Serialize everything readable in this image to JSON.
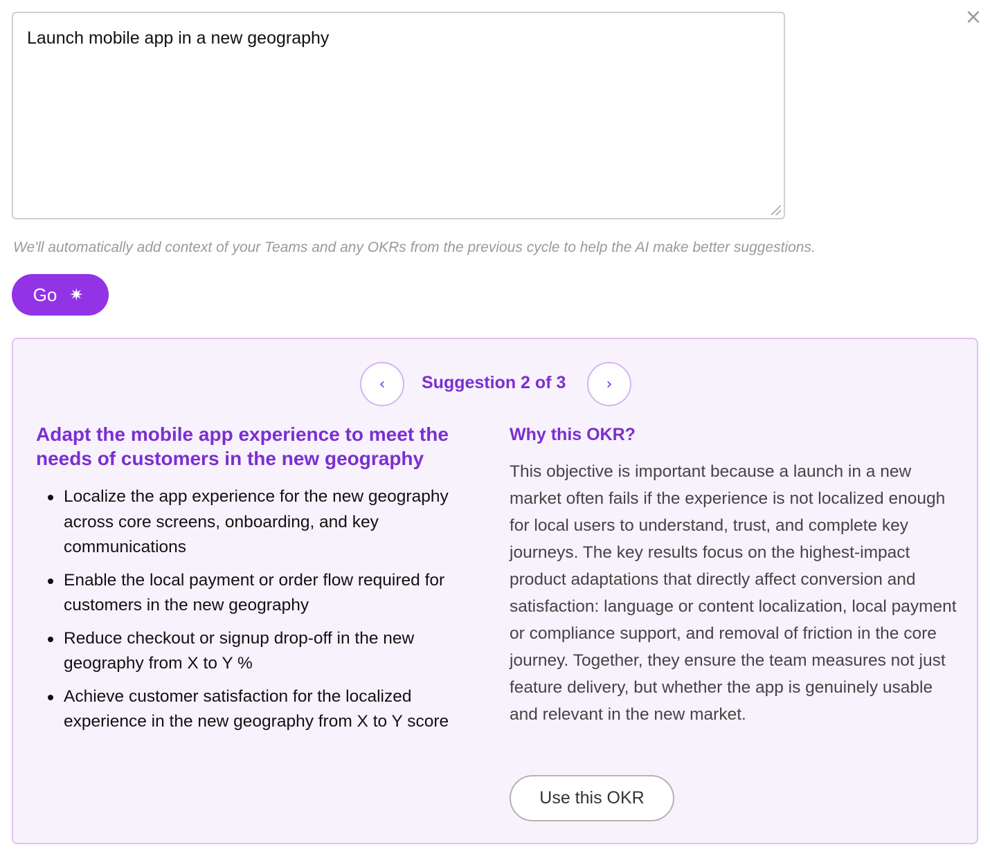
{
  "close": {
    "symbol": "×"
  },
  "prompt": {
    "value": "Launch mobile app in a new geography",
    "placeholder": ""
  },
  "context_note": "We'll automatically add context of your Teams and any OKRs from the previous cycle to help the AI make better suggestions.",
  "go_button": {
    "label": "Go",
    "icon": "sparkle-icon",
    "icon_glyph": "✷"
  },
  "suggestion": {
    "prev_glyph": "‹",
    "next_glyph": "›",
    "counter": "Suggestion 2 of 3",
    "objective": "Adapt the mobile app experience to meet the needs of customers in the new geography",
    "key_results": [
      "Localize the app experience for the new geography across core screens, onboarding, and key communications",
      "Enable the local payment or order flow required for customers in the new geography",
      "Reduce checkout or signup drop-off in the new geography from X to Y %",
      "Achieve customer satisfaction for the localized experience in the new geography from X to Y score"
    ],
    "why_title": "Why this OKR?",
    "why_body": "This objective is important because a launch in a new market often fails if the experience is not localized enough for local users to understand, trust, and complete key journeys. The key results focus on the highest-impact product adaptations that directly affect conversion and satisfaction: language or content localization, local payment or compliance support, and removal of friction in the core journey. Together, they ensure the team measures not just feature delivery, but whether the app is genuinely usable and relevant in the new market.",
    "use_button": "Use this OKR"
  },
  "colors": {
    "accent": "#9233e6",
    "accent_text": "#7b2fcf",
    "card_bg": "#f8f2fd",
    "card_border": "#e0c2f3"
  }
}
